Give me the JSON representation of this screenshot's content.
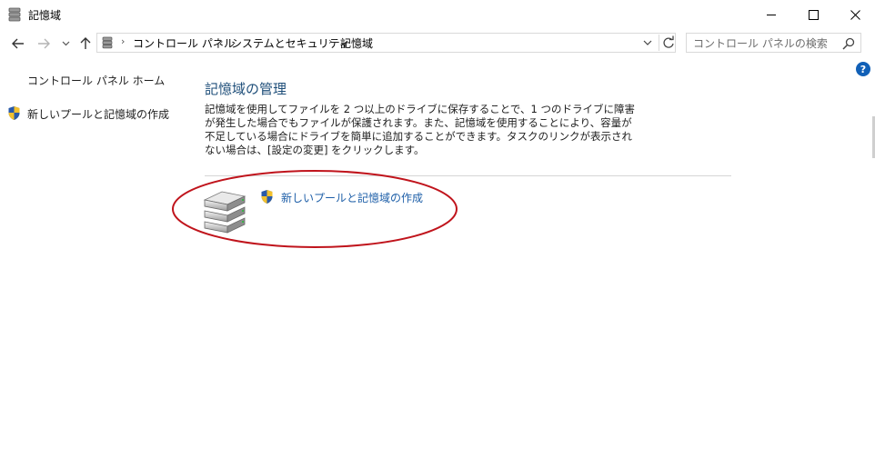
{
  "window": {
    "title": "記憶域",
    "minimize_icon": "minimize-icon",
    "maximize_icon": "maximize-icon",
    "close_icon": "close-icon"
  },
  "nav": {
    "back_icon": "arrow-left-icon",
    "forward_icon": "arrow-right-icon",
    "recent_icon": "chevron-down-icon",
    "up_icon": "arrow-up-icon"
  },
  "address": {
    "breadcrumbs": [
      "コントロール パネル",
      "システムとセキュリティ",
      "記憶域"
    ],
    "separator": "›",
    "dropdown_icon": "chevron-down-icon",
    "refresh_icon": "refresh-icon"
  },
  "search": {
    "placeholder": "コントロール パネルの検索",
    "icon": "search-icon"
  },
  "help": {
    "label": "?"
  },
  "left_pane": {
    "home_label": "コントロール パネル ホーム",
    "create_pool_label": "新しいプールと記憶域の作成"
  },
  "main": {
    "title": "記憶域の管理",
    "description": "記憶域を使用してファイルを 2 つ以上のドライブに保存することで、1 つのドライブに障害が発生した場合でもファイルが保護されます。また、記憶域を使用することにより、容量が不足している場合にドライブを簡単に追加することができます。タスクのリンクが表示されない場合は、[設定の変更] をクリックします。",
    "create_pool_link": "新しいプールと記憶域の作成",
    "storage_icon": "storage-spaces-icon",
    "shield_icon": "uac-shield-icon"
  },
  "colors": {
    "title_blue": "#1e4e79",
    "link_blue": "#1e5fa8",
    "annotation_red": "#c0141c"
  }
}
